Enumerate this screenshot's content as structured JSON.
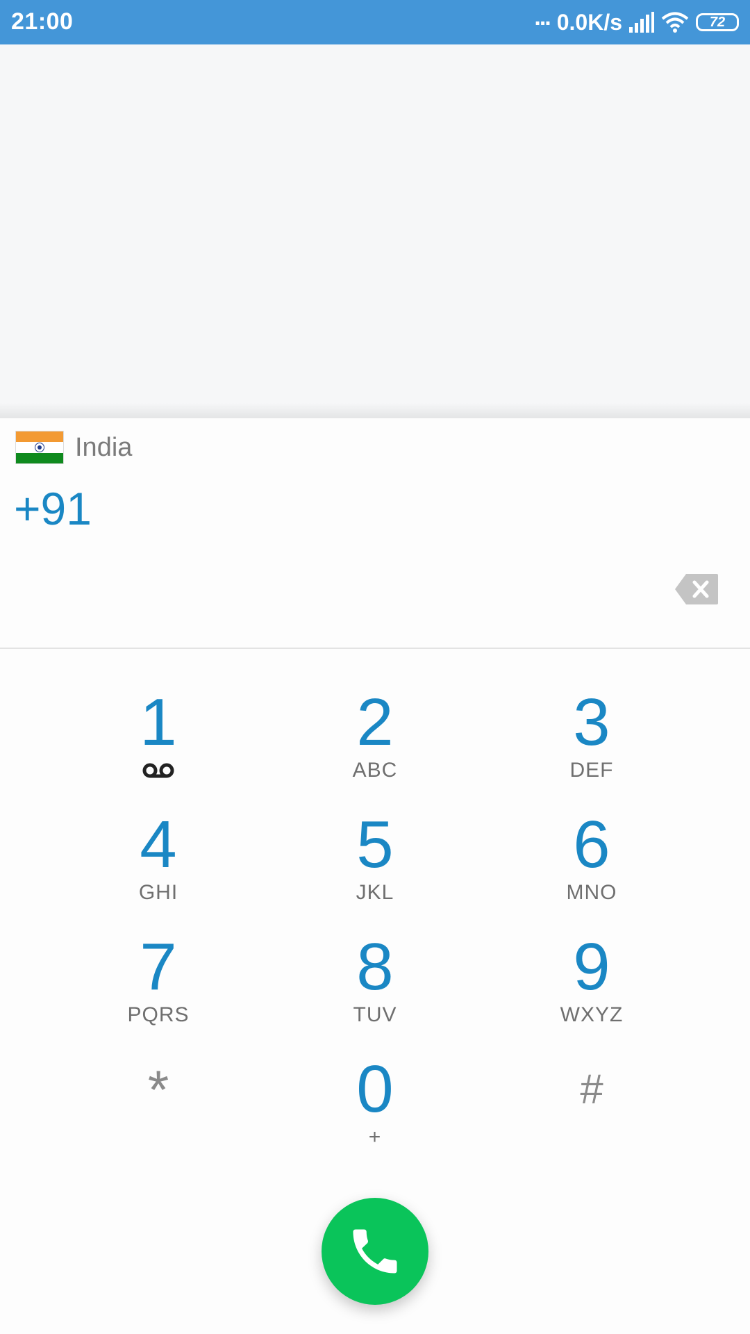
{
  "status_bar": {
    "time": "21:00",
    "dots": "...",
    "net_speed": "0.0K/s",
    "battery_level": "72",
    "icons": [
      "signal-icon",
      "wifi-icon",
      "battery-icon"
    ],
    "background_color": "#4496d8"
  },
  "dialer": {
    "country": {
      "name": "India",
      "flag_icon": "india-flag-icon",
      "flag_colors": [
        "#f39a33",
        "#ffffff",
        "#0f8a1e"
      ]
    },
    "number": "+91",
    "backspace_icon": "backspace-icon",
    "accent_color": "#1a87c4",
    "keys": [
      {
        "digit": "1",
        "letters": "",
        "extra_icon": "voicemail-icon"
      },
      {
        "digit": "2",
        "letters": "ABC"
      },
      {
        "digit": "3",
        "letters": "DEF"
      },
      {
        "digit": "4",
        "letters": "GHI"
      },
      {
        "digit": "5",
        "letters": "JKL"
      },
      {
        "digit": "6",
        "letters": "MNO"
      },
      {
        "digit": "7",
        "letters": "PQRS"
      },
      {
        "digit": "8",
        "letters": "TUV"
      },
      {
        "digit": "9",
        "letters": "WXYZ"
      },
      {
        "digit": "*",
        "letters": ""
      },
      {
        "digit": "0",
        "letters": "+"
      },
      {
        "digit": "#",
        "letters": ""
      }
    ],
    "call_button": {
      "icon": "phone-icon",
      "color": "#0ac45a"
    }
  }
}
